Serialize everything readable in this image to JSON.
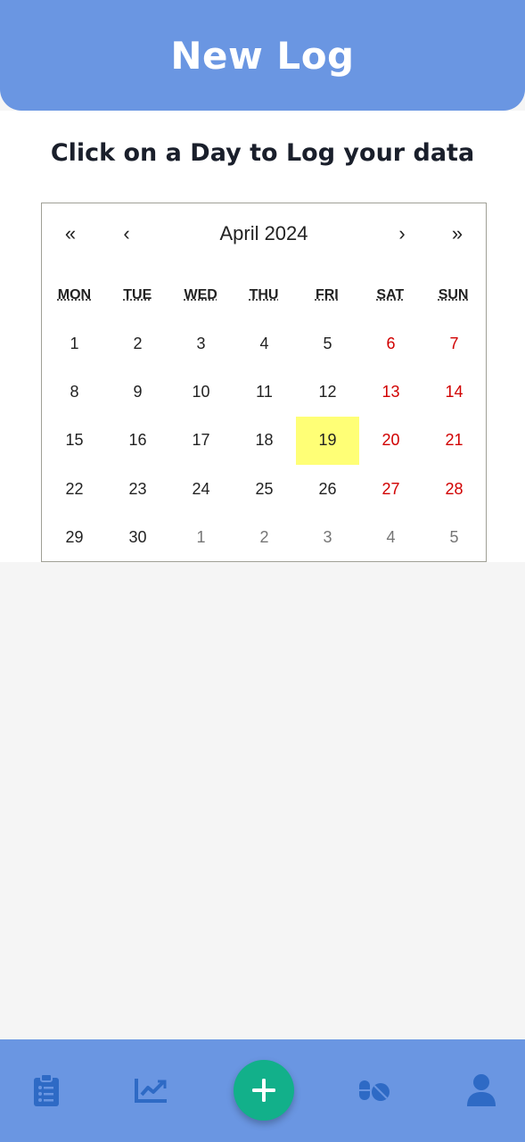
{
  "header": {
    "title": "New Log"
  },
  "instruction": "Click on a Day to Log your data",
  "calendar": {
    "nav": {
      "prev_year": "«",
      "prev_month": "‹",
      "label": "April 2024",
      "next_month": "›",
      "next_year": "»"
    },
    "weekdays": [
      "MON",
      "TUE",
      "WED",
      "THU",
      "FRI",
      "SAT",
      "SUN"
    ],
    "days": [
      {
        "d": "1",
        "t": "cur"
      },
      {
        "d": "2",
        "t": "cur"
      },
      {
        "d": "3",
        "t": "cur"
      },
      {
        "d": "4",
        "t": "cur"
      },
      {
        "d": "5",
        "t": "cur"
      },
      {
        "d": "6",
        "t": "we"
      },
      {
        "d": "7",
        "t": "we"
      },
      {
        "d": "8",
        "t": "cur"
      },
      {
        "d": "9",
        "t": "cur"
      },
      {
        "d": "10",
        "t": "cur"
      },
      {
        "d": "11",
        "t": "cur"
      },
      {
        "d": "12",
        "t": "cur"
      },
      {
        "d": "13",
        "t": "we"
      },
      {
        "d": "14",
        "t": "we"
      },
      {
        "d": "15",
        "t": "cur"
      },
      {
        "d": "16",
        "t": "cur"
      },
      {
        "d": "17",
        "t": "cur"
      },
      {
        "d": "18",
        "t": "cur"
      },
      {
        "d": "19",
        "t": "sel"
      },
      {
        "d": "20",
        "t": "we"
      },
      {
        "d": "21",
        "t": "we"
      },
      {
        "d": "22",
        "t": "cur"
      },
      {
        "d": "23",
        "t": "cur"
      },
      {
        "d": "24",
        "t": "cur"
      },
      {
        "d": "25",
        "t": "cur"
      },
      {
        "d": "26",
        "t": "cur"
      },
      {
        "d": "27",
        "t": "we"
      },
      {
        "d": "28",
        "t": "we"
      },
      {
        "d": "29",
        "t": "cur"
      },
      {
        "d": "30",
        "t": "cur"
      },
      {
        "d": "1",
        "t": "other"
      },
      {
        "d": "2",
        "t": "other"
      },
      {
        "d": "3",
        "t": "other"
      },
      {
        "d": "4",
        "t": "other"
      },
      {
        "d": "5",
        "t": "other"
      }
    ]
  },
  "colors": {
    "primary": "#6a96e2",
    "fab": "#12b08a",
    "icon": "#2e6ac5",
    "weekend": "#d10000",
    "selected": "#ffff76"
  },
  "bottom_nav": {
    "items": [
      "clipboard-list-icon",
      "chart-line-icon",
      "plus-icon",
      "pills-icon",
      "user-icon"
    ]
  }
}
